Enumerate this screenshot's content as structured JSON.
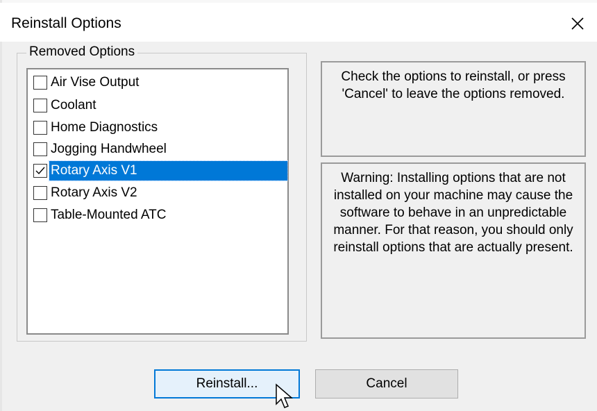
{
  "window": {
    "title": "Reinstall Options"
  },
  "group": {
    "label": "Removed Options"
  },
  "options": [
    {
      "label": "Air Vise Output",
      "checked": false,
      "selected": false
    },
    {
      "label": "Coolant",
      "checked": false,
      "selected": false
    },
    {
      "label": "Home Diagnostics",
      "checked": false,
      "selected": false
    },
    {
      "label": "Jogging Handwheel",
      "checked": false,
      "selected": false
    },
    {
      "label": "Rotary Axis V1",
      "checked": true,
      "selected": true
    },
    {
      "label": "Rotary Axis V2",
      "checked": false,
      "selected": false
    },
    {
      "label": "Table-Mounted ATC",
      "checked": false,
      "selected": false
    }
  ],
  "info": {
    "instructions": "Check the options to reinstall, or press 'Cancel' to leave the options removed.",
    "warning": "Warning: Installing options that are not installed on your machine may cause the software to behave in an unpredictable manner.  For that reason, you should only reinstall options that are actually present."
  },
  "buttons": {
    "reinstall": "Reinstall...",
    "cancel": "Cancel"
  },
  "colors": {
    "selection": "#0078d7",
    "window_bg": "#f0f0f0"
  },
  "icons": {
    "close": "close-icon",
    "cursor": "mouse-pointer-icon"
  }
}
